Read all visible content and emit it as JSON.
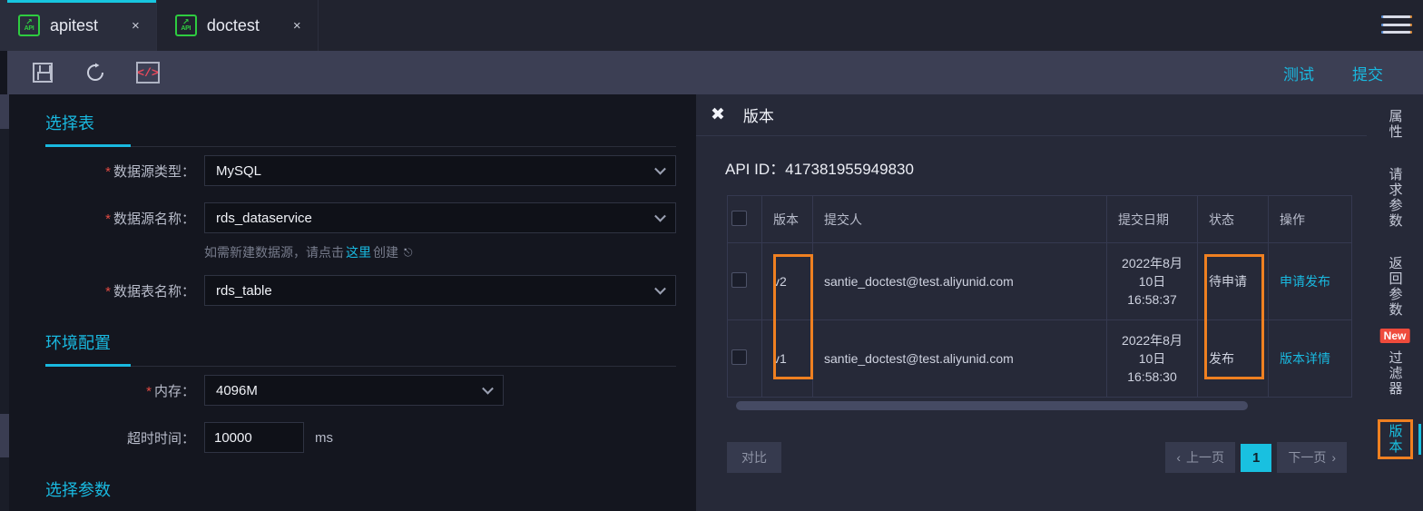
{
  "tabs": [
    {
      "label": "apitest",
      "icon": "api-icon",
      "close": "×",
      "active": true
    },
    {
      "label": "doctest",
      "icon": "api-icon",
      "close": "×",
      "active": false
    }
  ],
  "toolbar": {
    "save_icon": "save-icon",
    "refresh_icon": "refresh-icon",
    "code_icon": "code-icon",
    "code_glyph": "</>",
    "test_label": "测试",
    "submit_label": "提交"
  },
  "menu_icon": "hamburger-icon",
  "form": {
    "section_table": {
      "title": "选择表",
      "fields": {
        "datasource_type_label": "数据源类型：",
        "datasource_type_value": "MySQL",
        "datasource_name_label": "数据源名称：",
        "datasource_name_value": "rds_dataservice",
        "hint_prefix": "如需新建数据源，请点击",
        "hint_link": "这里",
        "hint_suffix": "创建",
        "table_name_label": "数据表名称：",
        "table_name_value": "rds_table"
      }
    },
    "section_env": {
      "title": "环境配置",
      "fields": {
        "memory_label": "内存：",
        "memory_value": "4096M",
        "timeout_label": "超时时间：",
        "timeout_value": "10000",
        "timeout_unit": "ms"
      }
    },
    "section_params": {
      "title": "选择参数"
    }
  },
  "version_panel": {
    "close_icon": "close-icon",
    "title": "版本",
    "api_id": "API ID：417381955949830",
    "columns": [
      "",
      "版本",
      "提交人",
      "提交日期",
      "状态",
      "操作"
    ],
    "rows": [
      {
        "version": "v2",
        "submitter": "santie_doctest@test.aliyunid.com",
        "date_line1": "2022年8月",
        "date_line2": "10日",
        "date_line3": "16:58:37",
        "status": "待申请",
        "action": "申请发布"
      },
      {
        "version": "v1",
        "submitter": "santie_doctest@test.aliyunid.com",
        "date_line1": "2022年8月",
        "date_line2": "10日",
        "date_line3": "16:58:30",
        "status": "发布",
        "action": "版本详情"
      }
    ],
    "compare_label": "对比",
    "pager": {
      "prev": "上一页",
      "current": "1",
      "next": "下一页",
      "prev_icon": "chevron-left-icon",
      "next_icon": "chevron-right-icon"
    }
  },
  "right_rail": {
    "items": [
      {
        "label": "属性",
        "active": false,
        "badge": ""
      },
      {
        "label": "请求参数",
        "active": false,
        "badge": ""
      },
      {
        "label": "返回参数",
        "active": false,
        "badge": ""
      },
      {
        "label": "过滤器",
        "active": false,
        "badge": "New"
      },
      {
        "label": "版本",
        "active": true,
        "badge": ""
      }
    ]
  },
  "colors": {
    "accent_cyan": "#19b9e0",
    "annotation_orange": "#ef8021",
    "required_red": "#e04a42",
    "badge_red": "#ef4b3c",
    "panel_bg": "#262938",
    "form_bg": "#14161f",
    "toolbar_bg": "#3c3f54"
  }
}
